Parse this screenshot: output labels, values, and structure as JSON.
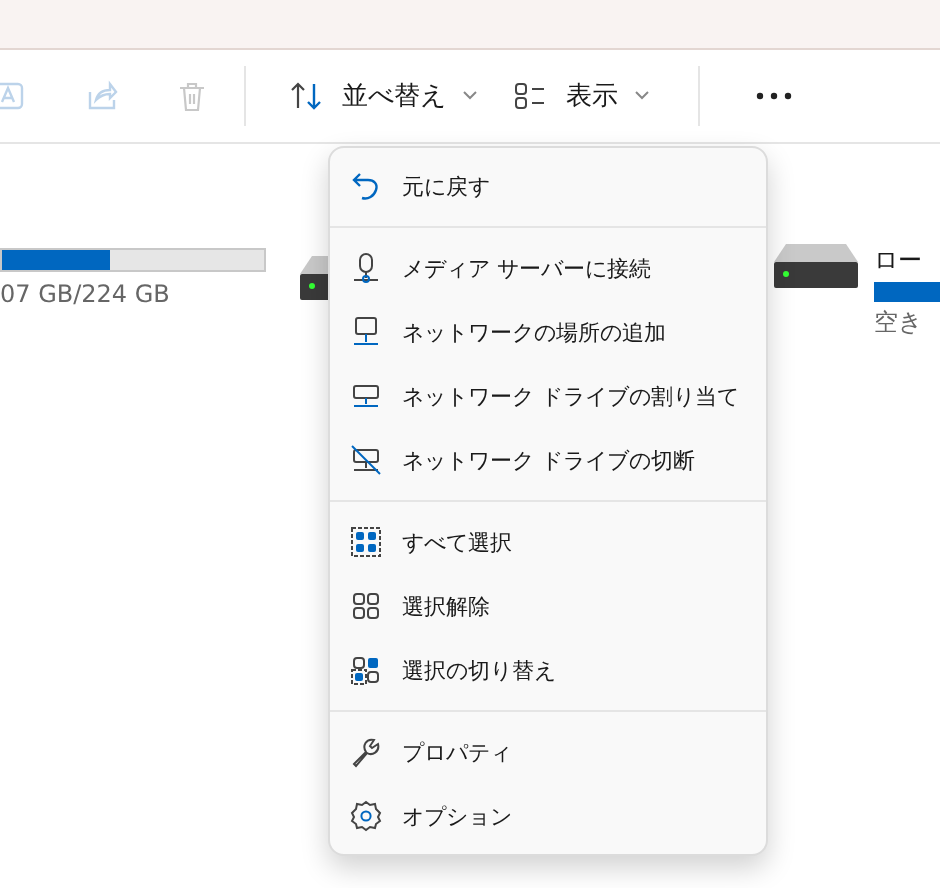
{
  "toolbar": {
    "sort": {
      "label": "並べ替え"
    },
    "view": {
      "label": "表示"
    }
  },
  "drives": [
    {
      "kind": "bar-left",
      "usage": "07 GB/224 GB",
      "level": 0.41
    },
    {
      "kind": "icon-only"
    },
    {
      "kind": "cut-right",
      "name": "ロー",
      "free": "空き",
      "level": 1
    }
  ],
  "context_menu": {
    "groups": [
      {
        "items": [
          {
            "kind": "undo",
            "label": "元に戻す"
          }
        ]
      },
      {
        "items": [
          {
            "kind": "media",
            "label": "メディア サーバーに接続"
          },
          {
            "kind": "netloc",
            "label": "ネットワークの場所の追加"
          },
          {
            "kind": "map",
            "label": "ネットワーク ドライブの割り当て"
          },
          {
            "kind": "disconnect",
            "label": "ネットワーク ドライブの切断"
          }
        ]
      },
      {
        "items": [
          {
            "kind": "selall",
            "label": "すべて選択"
          },
          {
            "kind": "selnone",
            "label": "選択解除"
          },
          {
            "kind": "invert",
            "label": "選択の切り替え"
          }
        ]
      },
      {
        "items": [
          {
            "kind": "props",
            "label": "プロパティ"
          },
          {
            "kind": "options",
            "label": "オプション"
          }
        ]
      }
    ]
  }
}
